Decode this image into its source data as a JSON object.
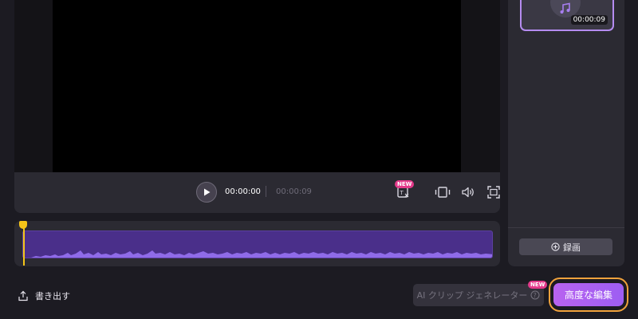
{
  "player": {
    "current_time": "00:00:00",
    "total_time": "00:00:09",
    "new_badge": "NEW"
  },
  "timeline": {
    "playhead_position": 0
  },
  "side_panel": {
    "thumbnail": {
      "duration": "00:00:09",
      "icon": "music-note-icon"
    },
    "record_label": "録画"
  },
  "footer": {
    "export_label": "書き出す",
    "ai_generator_label": "AI クリップ ジェネレーター",
    "ai_new_badge": "NEW",
    "advanced_edit_label": "高度な編集"
  },
  "colors": {
    "accent": "#a763f0",
    "highlight_outline": "#f0a23c",
    "playhead": "#f5c518",
    "waveform": "#8f6be8",
    "badge": "#e43a8b"
  }
}
